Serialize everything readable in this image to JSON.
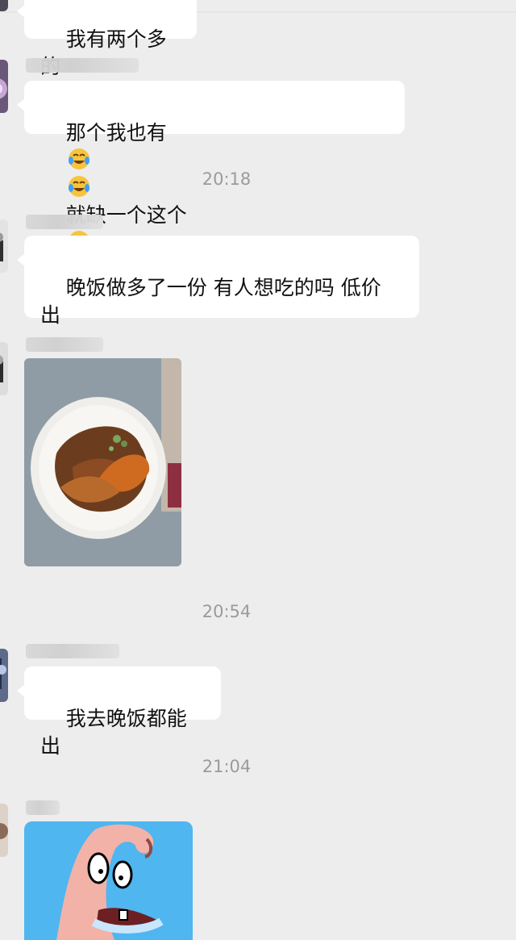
{
  "chat": {
    "messages": [
      {
        "text": "我有两个多的"
      },
      {
        "text_parts": [
          "那个我也有",
          "就缺一个这个"
        ],
        "emoji_name": "crying-laughing-emoji"
      },
      {
        "time": "20:18"
      },
      {
        "text": "晚饭做多了一份 有人想吃的吗 低价\n出"
      },
      {
        "image": "food-photo"
      },
      {
        "time": "20:54"
      },
      {
        "text": "我去晚饭都能出"
      },
      {
        "time": "21:04"
      },
      {
        "image": "patrick-sticker"
      }
    ]
  },
  "colors": {
    "background": "#ededed",
    "bubble": "#ffffff",
    "timestamp": "#9b9b9b",
    "text": "#111111"
  }
}
